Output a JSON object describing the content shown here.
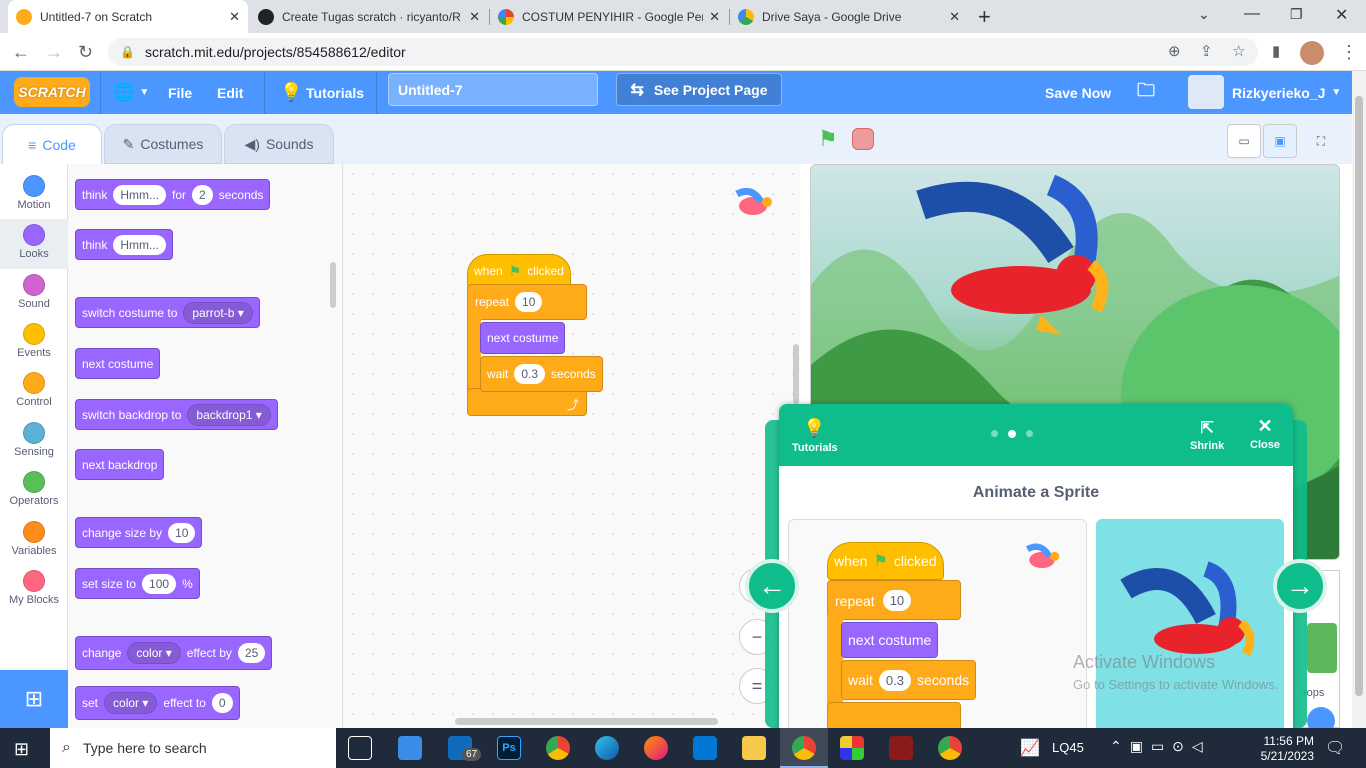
{
  "browser": {
    "tabs": [
      {
        "label": "Untitled-7 on Scratch",
        "active": true
      },
      {
        "label": "Create Tugas scratch · ricyanto/R"
      },
      {
        "label": "COSTUM PENYIHIR - Google Pen"
      },
      {
        "label": "Drive Saya - Google Drive"
      }
    ],
    "new_tab": "+",
    "url": "scratch.mit.edu/projects/854588612/editor"
  },
  "menu": {
    "logo": "SCRATCH",
    "file": "File",
    "edit": "Edit",
    "tutorials": "Tutorials",
    "project_title": "Untitled-7",
    "see_project": "See Project Page",
    "save_now": "Save Now",
    "username": "Rizkyerieko_J"
  },
  "editor_tabs": {
    "code": "Code",
    "costumes": "Costumes",
    "sounds": "Sounds"
  },
  "categories": [
    {
      "label": "Motion",
      "color": "#4c97ff"
    },
    {
      "label": "Looks",
      "color": "#9966ff"
    },
    {
      "label": "Sound",
      "color": "#cf63cf"
    },
    {
      "label": "Events",
      "color": "#ffbf00"
    },
    {
      "label": "Control",
      "color": "#ffab19"
    },
    {
      "label": "Sensing",
      "color": "#5cb1d6"
    },
    {
      "label": "Operators",
      "color": "#59c059"
    },
    {
      "label": "Variables",
      "color": "#ff8c1a"
    },
    {
      "label": "My Blocks",
      "color": "#ff6680"
    }
  ],
  "palette": {
    "think_for": {
      "a": "think",
      "b": "Hmm...",
      "c": "for",
      "d": "2",
      "e": "seconds"
    },
    "think": {
      "a": "think",
      "b": "Hmm..."
    },
    "switch_costume": {
      "a": "switch costume to",
      "b": "parrot-b"
    },
    "next_costume": "next costume",
    "switch_backdrop": {
      "a": "switch backdrop to",
      "b": "backdrop1"
    },
    "next_backdrop": "next backdrop",
    "change_size": {
      "a": "change size by",
      "b": "10"
    },
    "set_size": {
      "a": "set size to",
      "b": "100",
      "c": "%"
    },
    "change_effect": {
      "a": "change",
      "b": "color",
      "c": "effect by",
      "d": "25"
    },
    "set_effect": {
      "a": "set",
      "b": "color",
      "c": "effect to",
      "d": "0"
    }
  },
  "script": {
    "when": "when",
    "clicked": "clicked",
    "repeat": "repeat",
    "repeat_n": "10",
    "next_costume": "next costume",
    "wait": "wait",
    "wait_n": "0.3",
    "seconds": "seconds"
  },
  "tutorial": {
    "tutorials_label": "Tutorials",
    "shrink": "Shrink",
    "close": "Close",
    "title": "Animate a Sprite",
    "step_current": 2,
    "step_total": 3
  },
  "stage_partial": {
    "backdrops_label": "rops"
  },
  "watermark": {
    "line1": "Activate Windows",
    "line2": "Go to Settings to activate Windows."
  },
  "taskbar": {
    "search_placeholder": "Type here to search",
    "mail_badge": "67",
    "stock": "LQ45",
    "time": "11:56 PM",
    "date": "5/21/2023"
  }
}
